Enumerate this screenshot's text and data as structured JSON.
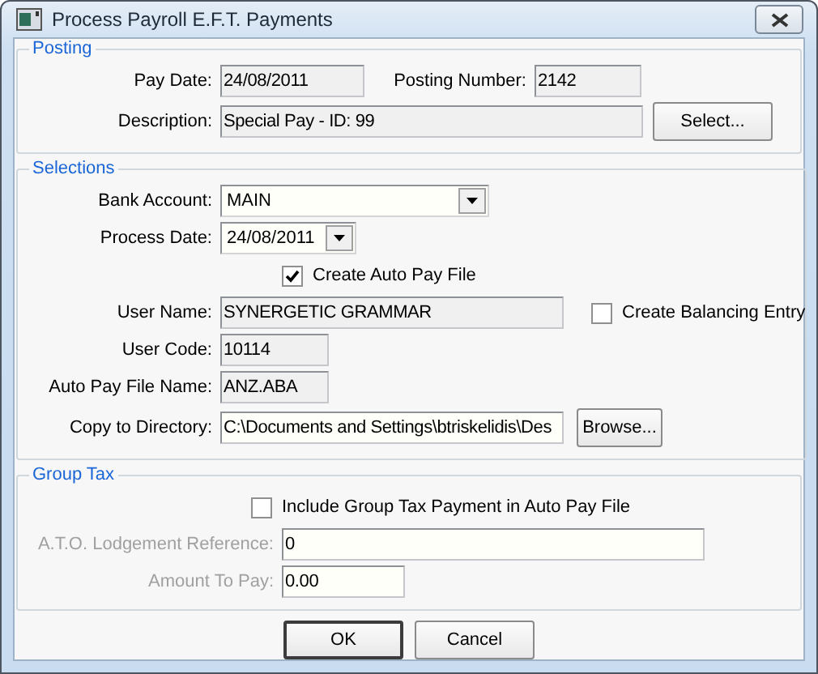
{
  "window": {
    "title": "Process Payroll E.F.T. Payments"
  },
  "groups": [
    {
      "legend": "Posting",
      "rows": [
        {
          "items": [
            {
              "kind": "field",
              "label": "Pay Date:",
              "value": "24/08/2011",
              "readonly": true,
              "disabled": false
            },
            {
              "kind": "field",
              "label": "Posting Number:",
              "value": "2142",
              "readonly": true,
              "disabled": false
            }
          ]
        },
        {
          "items": [
            {
              "kind": "field",
              "label": "Description:",
              "value": "Special Pay - ID: 99",
              "readonly": true,
              "disabled": false
            },
            {
              "kind": "button",
              "label": "Select..."
            }
          ]
        }
      ]
    },
    {
      "legend": "Selections",
      "rows": [
        {
          "items": [
            {
              "kind": "combo",
              "label": "Bank Account:",
              "value": "MAIN"
            }
          ]
        },
        {
          "items": [
            {
              "kind": "combo",
              "label": "Process Date:",
              "value": "24/08/2011"
            }
          ]
        },
        {
          "items": [
            {
              "kind": "checkbox",
              "label": "Create Auto Pay File",
              "checked": true
            }
          ]
        },
        {
          "items": [
            {
              "kind": "field",
              "label": "User Name:",
              "value": "SYNERGETIC GRAMMAR",
              "readonly": true,
              "disabled": false
            },
            {
              "kind": "checkbox",
              "label": "Create Balancing Entry",
              "checked": false
            }
          ]
        },
        {
          "items": [
            {
              "kind": "field",
              "label": "User Code:",
              "value": "10114",
              "readonly": true,
              "disabled": false
            }
          ]
        },
        {
          "items": [
            {
              "kind": "field",
              "label": "Auto Pay File Name:",
              "value": "ANZ.ABA",
              "readonly": true,
              "disabled": false
            }
          ]
        },
        {
          "items": [
            {
              "kind": "field",
              "label": "Copy to Directory:",
              "value": "C:\\Documents and Settings\\btriskelidis\\Des",
              "readonly": false,
              "disabled": false
            },
            {
              "kind": "button",
              "label": "Browse..."
            }
          ]
        }
      ]
    },
    {
      "legend": "Group Tax",
      "rows": [
        {
          "items": [
            {
              "kind": "checkbox",
              "label": "Include Group Tax Payment in Auto Pay File",
              "checked": false
            }
          ]
        },
        {
          "items": [
            {
              "kind": "field",
              "label": "A.T.O. Lodgement Reference:",
              "value": "0",
              "readonly": false,
              "disabled": true
            }
          ]
        },
        {
          "items": [
            {
              "kind": "field",
              "label": "Amount To Pay:",
              "value": "0.00",
              "readonly": false,
              "disabled": true
            }
          ]
        }
      ]
    }
  ],
  "buttons": [
    {
      "label": "OK",
      "default": true
    },
    {
      "label": "Cancel",
      "default": false
    }
  ]
}
